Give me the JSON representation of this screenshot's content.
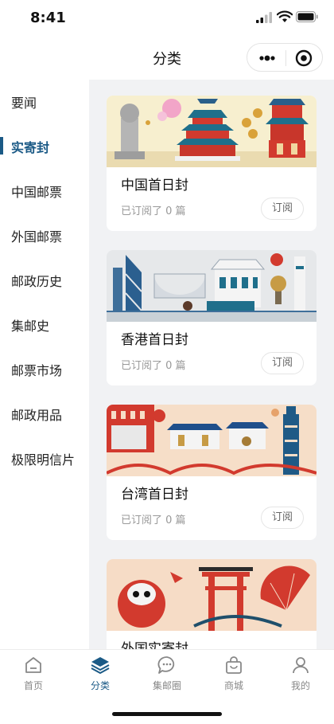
{
  "status_bar": {
    "time": "8:41"
  },
  "nav": {
    "title": "分类"
  },
  "sidebar": {
    "items": [
      {
        "label": "要闻"
      },
      {
        "label": "实寄封"
      },
      {
        "label": "中国邮票"
      },
      {
        "label": "外国邮票"
      },
      {
        "label": "邮政历史"
      },
      {
        "label": "集邮史"
      },
      {
        "label": "邮票市场"
      },
      {
        "label": "邮政用品"
      },
      {
        "label": "极限明信片"
      }
    ],
    "active_index": 1
  },
  "cards": [
    {
      "title": "中国首日封",
      "subscribed": "已订阅了 0 篇",
      "button": "订阅"
    },
    {
      "title": "香港首日封",
      "subscribed": "已订阅了 0 篇",
      "button": "订阅"
    },
    {
      "title": "台湾首日封",
      "subscribed": "已订阅了 0 篇",
      "button": "订阅"
    },
    {
      "title": "外国实寄封"
    }
  ],
  "tabs": [
    {
      "label": "首页",
      "icon": "home-icon"
    },
    {
      "label": "分类",
      "icon": "layers-icon"
    },
    {
      "label": "集邮圈",
      "icon": "chat-bubble-icon"
    },
    {
      "label": "商城",
      "icon": "shopping-bag-icon"
    },
    {
      "label": "我的",
      "icon": "person-icon"
    }
  ],
  "colors": {
    "accent": "#1b5a86",
    "content_bg": "#f1f2f4",
    "muted_text": "#999999"
  }
}
